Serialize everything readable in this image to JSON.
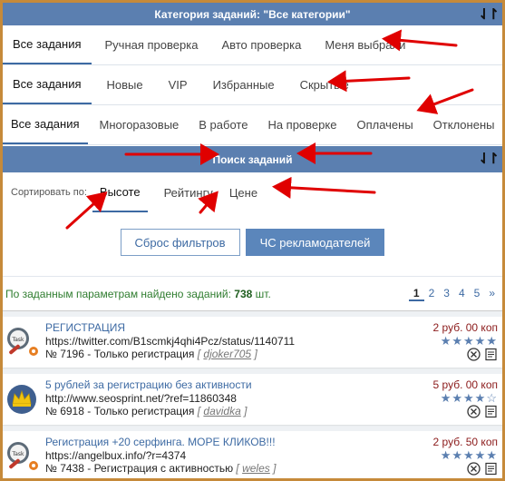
{
  "category_bar": {
    "title": "Категория заданий: \"Все категории\"",
    "sort_icon": "⇃↾"
  },
  "row1": [
    "Все задания",
    "Ручная проверка",
    "Авто проверка",
    "Меня выбрали"
  ],
  "row2": [
    "Все задания",
    "Новые",
    "VIP",
    "Избранные",
    "Скрытые"
  ],
  "row3": [
    "Все задания",
    "Многоразовые",
    "В работе",
    "На проверке",
    "Оплачены",
    "Отклонены"
  ],
  "search_bar": {
    "title": "Поиск заданий",
    "sort_icon": "⇃↾"
  },
  "sort": {
    "label": "Сортировать по:",
    "options": [
      "Высоте",
      "Рейтингу",
      "Цене"
    ]
  },
  "buttons": {
    "reset": "Сброс фильтров",
    "blacklist": "ЧС рекламодателей"
  },
  "found": {
    "prefix": "По заданным параметрам найдено заданий:",
    "count": "738",
    "suffix": "шт."
  },
  "pager": [
    "1",
    "2",
    "3",
    "4",
    "5",
    "»"
  ],
  "tasks": [
    {
      "icon": "task-gear-icon",
      "title": "РЕГИСТРАЦИЯ",
      "url": "https://twitter.com/B1scmkj4qhi4Pcz/status/1140711",
      "number": "№ 7196",
      "type": "Только регистрация",
      "author": "djoker705",
      "price": "2 руб. 00 коп",
      "rating": 5
    },
    {
      "icon": "crown-icon",
      "title": "5 рублей за регистрацию без активности",
      "url": "http://www.seosprint.net/?ref=11860348",
      "number": "№ 6918",
      "type": "Только регистрация",
      "author": "davidka",
      "price": "5 руб. 00 коп",
      "rating": 4
    },
    {
      "icon": "task-gear-icon",
      "title": "Регистрация +20 серфинга. МОРЕ КЛИКОВ!!!",
      "url": "https://angelbux.info/?r=4374",
      "number": "№ 7438",
      "type": "Регистрация с активностью",
      "author": "weles",
      "price": "2 руб. 50 коп",
      "rating": 5
    }
  ],
  "colors": {
    "bar": "#5b7fb0",
    "accent": "#3d6aa3",
    "arrow": "#e00000",
    "price": "#8b1a1a",
    "found": "#2f7d2f"
  }
}
